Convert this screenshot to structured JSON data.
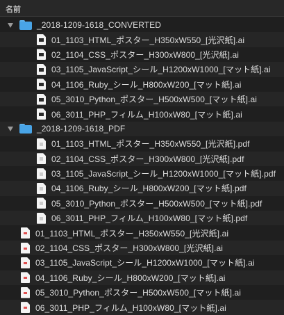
{
  "header": {
    "column_name": "名前"
  },
  "colors": {
    "folder": "#49a4e6",
    "background": "#1f1f1f",
    "text": "#dedede"
  },
  "rows": [
    {
      "kind": "folder",
      "label": "_2018-1209-1618_CONVERTED",
      "icon": "folder-icon"
    },
    {
      "kind": "file",
      "label": "01_1103_HTML_ポスター_H350xW550_[光沢紙].ai",
      "icon": "ai-file-icon"
    },
    {
      "kind": "file",
      "label": "02_1104_CSS_ポスター_H300xW800_[光沢紙].ai",
      "icon": "ai-file-icon"
    },
    {
      "kind": "file",
      "label": "03_1105_JavaScript_シール_H1200xW1000_[マット紙].ai",
      "icon": "ai-file-icon"
    },
    {
      "kind": "file",
      "label": "04_1106_Ruby_シール_H800xW200_[マット紙].ai",
      "icon": "ai-file-icon"
    },
    {
      "kind": "file",
      "label": "05_3010_Python_ポスター_H500xW500_[マット紙].ai",
      "icon": "ai-file-icon"
    },
    {
      "kind": "file",
      "label": "06_3011_PHP_フィルム_H100xW80_[マット紙].ai",
      "icon": "ai-file-icon"
    },
    {
      "kind": "folder",
      "label": "_2018-1209-1618_PDF",
      "icon": "folder-icon"
    },
    {
      "kind": "file",
      "label": "01_1103_HTML_ポスター_H350xW550_[光沢紙].pdf",
      "icon": "pdf-file-icon"
    },
    {
      "kind": "file",
      "label": "02_1104_CSS_ポスター_H300xW800_[光沢紙].pdf",
      "icon": "pdf-file-icon"
    },
    {
      "kind": "file",
      "label": "03_1105_JavaScript_シール_H1200xW1000_[マット紙].pdf",
      "icon": "pdf-file-icon"
    },
    {
      "kind": "file",
      "label": "04_1106_Ruby_シール_H800xW200_[マット紙].pdf",
      "icon": "pdf-file-icon"
    },
    {
      "kind": "file",
      "label": "05_3010_Python_ポスター_H500xW500_[マット紙].pdf",
      "icon": "pdf-file-icon"
    },
    {
      "kind": "file",
      "label": "06_3011_PHP_フィルム_H100xW80_[マット紙].pdf",
      "icon": "pdf-file-icon"
    },
    {
      "kind": "file",
      "label": "01_1103_HTML_ポスター_H350xW550_[光沢紙].ai",
      "icon": "ai-file-icon"
    },
    {
      "kind": "file",
      "label": "02_1104_CSS_ポスター_H300xW800_[光沢紙].ai",
      "icon": "ai-file-icon"
    },
    {
      "kind": "file",
      "label": "03_1105_JavaScript_シール_H1200xW1000_[マット紙].ai",
      "icon": "ai-file-icon"
    },
    {
      "kind": "file",
      "label": "04_1106_Ruby_シール_H800xW200_[マット紙].ai",
      "icon": "ai-file-icon"
    },
    {
      "kind": "file",
      "label": "05_3010_Python_ポスター_H500xW500_[マット紙].ai",
      "icon": "ai-file-icon"
    },
    {
      "kind": "file",
      "label": "06_3011_PHP_フィルム_H100xW80_[マット紙].ai",
      "icon": "ai-file-icon"
    }
  ]
}
